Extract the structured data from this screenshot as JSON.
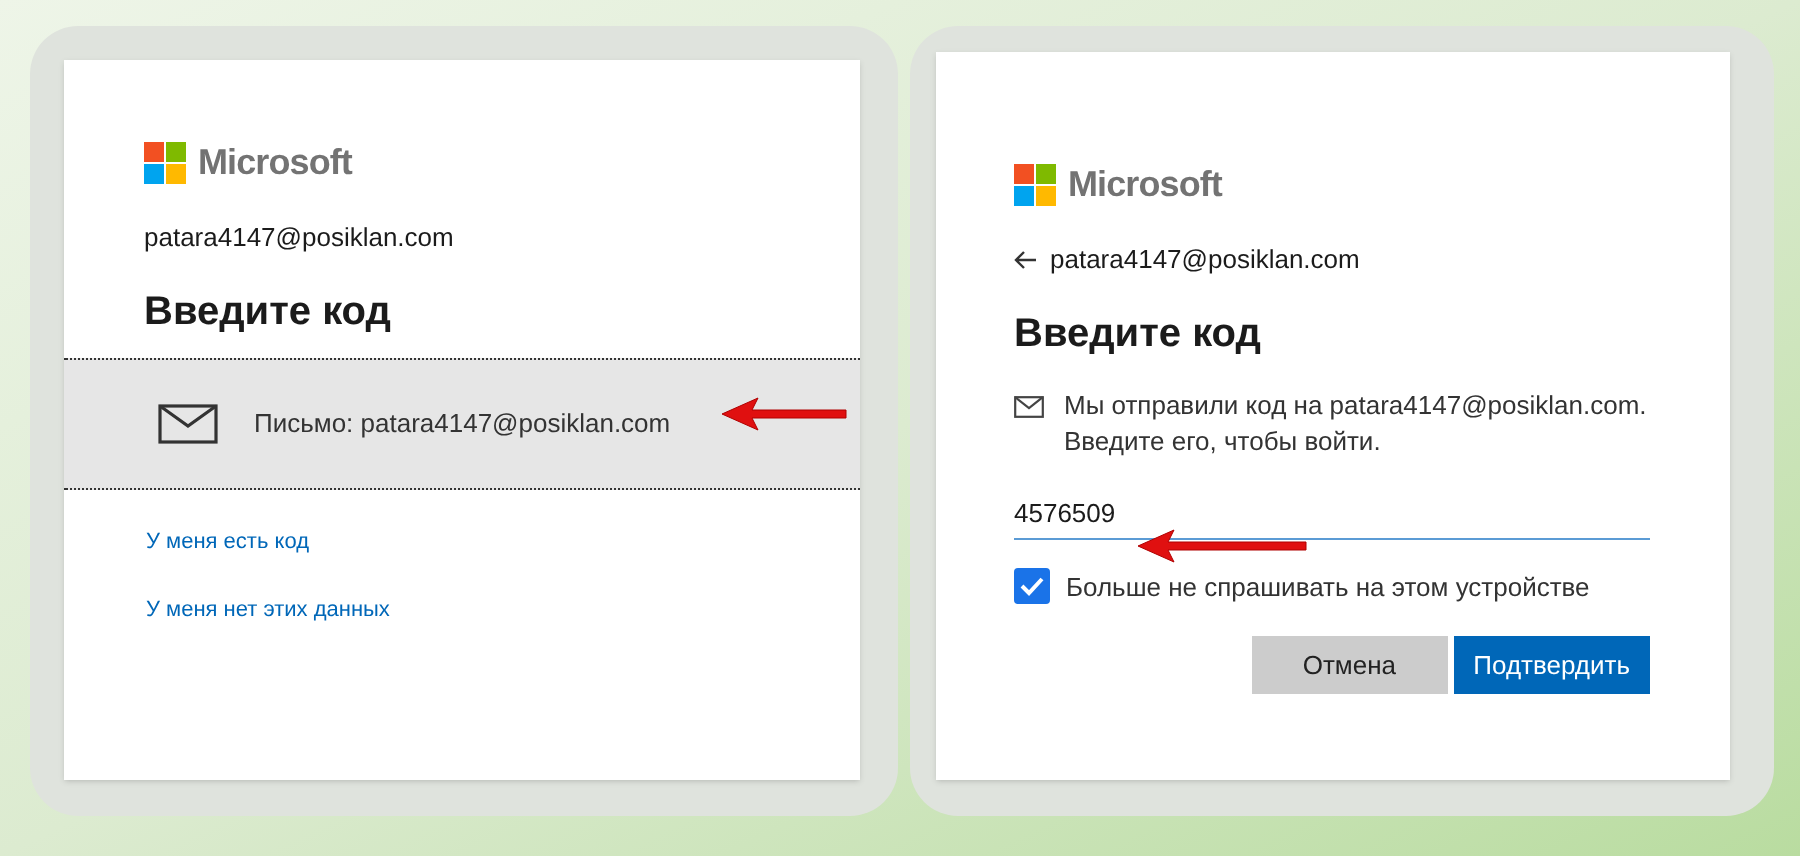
{
  "left_panel": {
    "brand": "Microsoft",
    "email": "patara4147@posiklan.com",
    "title": "Введите код",
    "option": {
      "label": "Письмо: patara4147@posiklan.com",
      "selected": true
    },
    "links": [
      "У меня есть код",
      "У меня нет этих данных"
    ]
  },
  "right_panel": {
    "brand": "Microsoft",
    "back_email": "patara4147@posiklan.com",
    "title": "Введите код",
    "message": "Мы отправили код на patara4147@posiklan.com. Введите его, чтобы войти.",
    "code_field": {
      "value": "4576509"
    },
    "remember": {
      "label": "Больше не спрашивать на этом устройстве",
      "checked": true
    },
    "buttons": [
      {
        "label": "Отмена",
        "kind": "secondary"
      },
      {
        "label": "Подтвердить",
        "kind": "primary"
      }
    ]
  }
}
